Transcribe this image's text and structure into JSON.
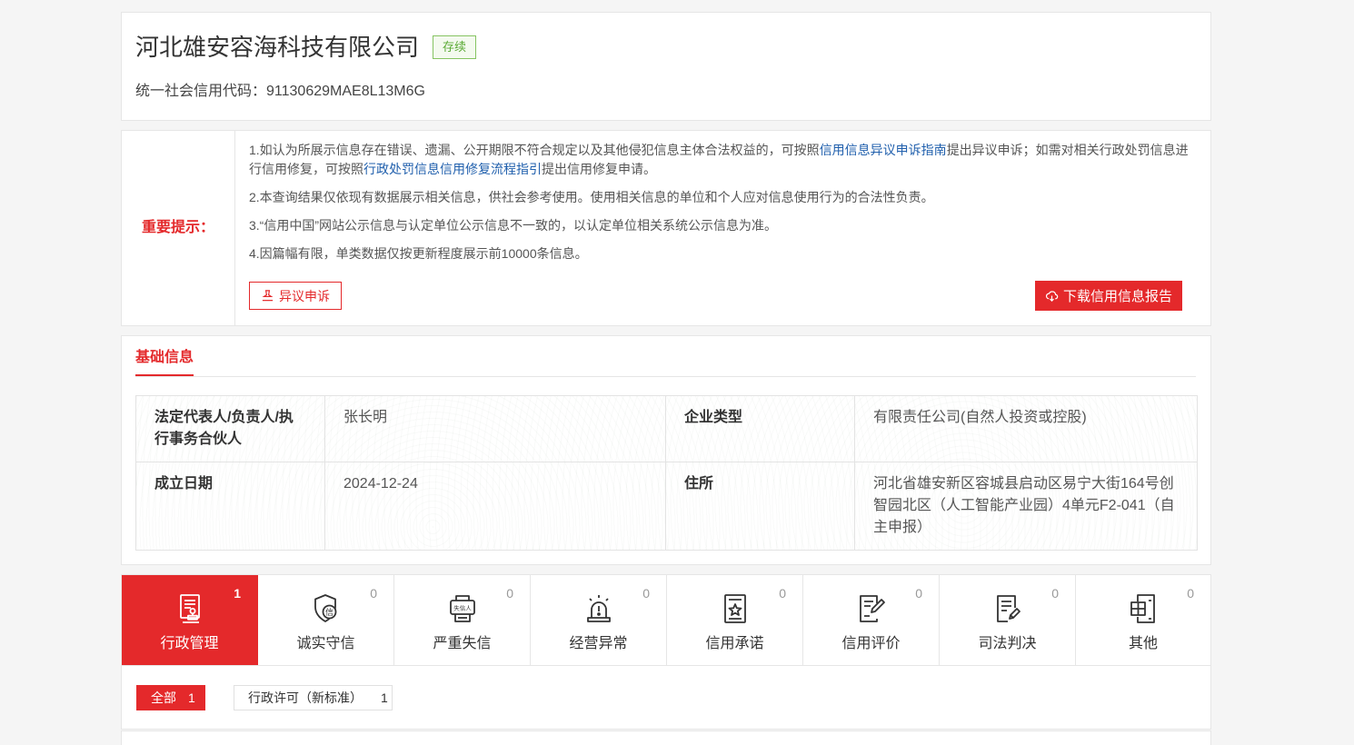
{
  "colors": {
    "accent": "#e4292b",
    "status_green": "#5aaa34",
    "link": "#2160ad"
  },
  "company": {
    "name": "河北雄安容海科技有限公司",
    "status": "存续",
    "credit_code_label": "统一社会信用代码：",
    "credit_code": "91130629MAE8L13M6G"
  },
  "notice": {
    "title": "重要提示：",
    "item1": {
      "text_a": "1.如认为所展示信息存在错误、遗漏、公开期限不符合规定以及其他侵犯信息主体合法权益的，可按照",
      "link_a": "信用信息异议申诉指南",
      "text_b": "提出异议申诉；如需对相关行政处罚信息进行信用修复，可按照",
      "link_b": "行政处罚信息信用修复流程指引",
      "text_c": "提出信用修复申请。"
    },
    "items": [
      "2.本查询结果仅依现有数据展示相关信息，供社会参考使用。使用相关信息的单位和个人应对信息使用行为的合法性负责。",
      "3.“信用中国”网站公示信息与认定单位公示信息不一致的，以认定单位相关系统公示信息为准。",
      "4.因篇幅有限，单类数据仅按更新程度展示前10000条信息。"
    ],
    "appeal_button": "异议申诉",
    "appeal_icon": "stamp-icon",
    "download_button": "下载信用信息报告",
    "download_icon": "cloud-download-icon"
  },
  "basic_info": {
    "tab_label": "基础信息",
    "fields": [
      {
        "label": "法定代表人/负责人/执行事务合伙人",
        "value": "张长明"
      },
      {
        "label": "企业类型",
        "value": "有限责任公司(自然人投资或控股)"
      },
      {
        "label": "成立日期",
        "value": "2024-12-24"
      },
      {
        "label": "住所",
        "value": "河北省雄安新区容城县启动区易宁大街164号创智园北区（人工智能产业园）4单元F2-041（自主申报）"
      }
    ]
  },
  "risk_tabs": [
    {
      "label": "行政管理",
      "count": "1",
      "icon": "document-stamp-icon",
      "active": true
    },
    {
      "label": "诚实守信",
      "count": "0",
      "icon": "shield-credit-icon",
      "icon_text": "信",
      "active": false
    },
    {
      "label": "严重失信",
      "count": "0",
      "icon": "dishonest-board-icon",
      "icon_text": "失信人",
      "active": false
    },
    {
      "label": "经营异常",
      "count": "0",
      "icon": "alarm-light-icon",
      "active": false
    },
    {
      "label": "信用承诺",
      "count": "0",
      "icon": "document-star-icon",
      "active": false
    },
    {
      "label": "信用评价",
      "count": "0",
      "icon": "document-pen-icon",
      "active": false
    },
    {
      "label": "司法判决",
      "count": "0",
      "icon": "document-gavel-icon",
      "active": false
    },
    {
      "label": "其他",
      "count": "0",
      "icon": "document-grid-icon",
      "active": false
    }
  ],
  "filters": [
    {
      "label": "全部",
      "count": "1",
      "active": true
    },
    {
      "label": "行政许可（新标准）",
      "count": "1",
      "active": false
    }
  ]
}
